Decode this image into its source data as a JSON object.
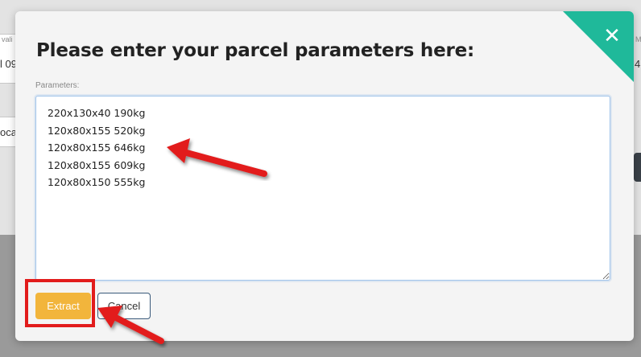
{
  "background_fragments": {
    "frag1": "vali",
    "frag2": "l 09",
    "frag3": "oca",
    "frag4": "M",
    "frag5": "4"
  },
  "modal": {
    "title": "Please enter your parcel parameters here:",
    "close_icon": "close-icon",
    "close_glyph": "✕",
    "parameters_label": "Parameters:",
    "parameters_value": "220x130x40 190kg\n120x80x155 520kg\n120x80x155 646kg\n120x80x155 609kg\n120x80x150 555kg",
    "extract_label": "Extract",
    "cancel_label": "Cancel"
  },
  "colors": {
    "accent_teal": "#1fb99a",
    "extract_button": "#f2b53c",
    "annotation_red": "#e21c1c"
  }
}
